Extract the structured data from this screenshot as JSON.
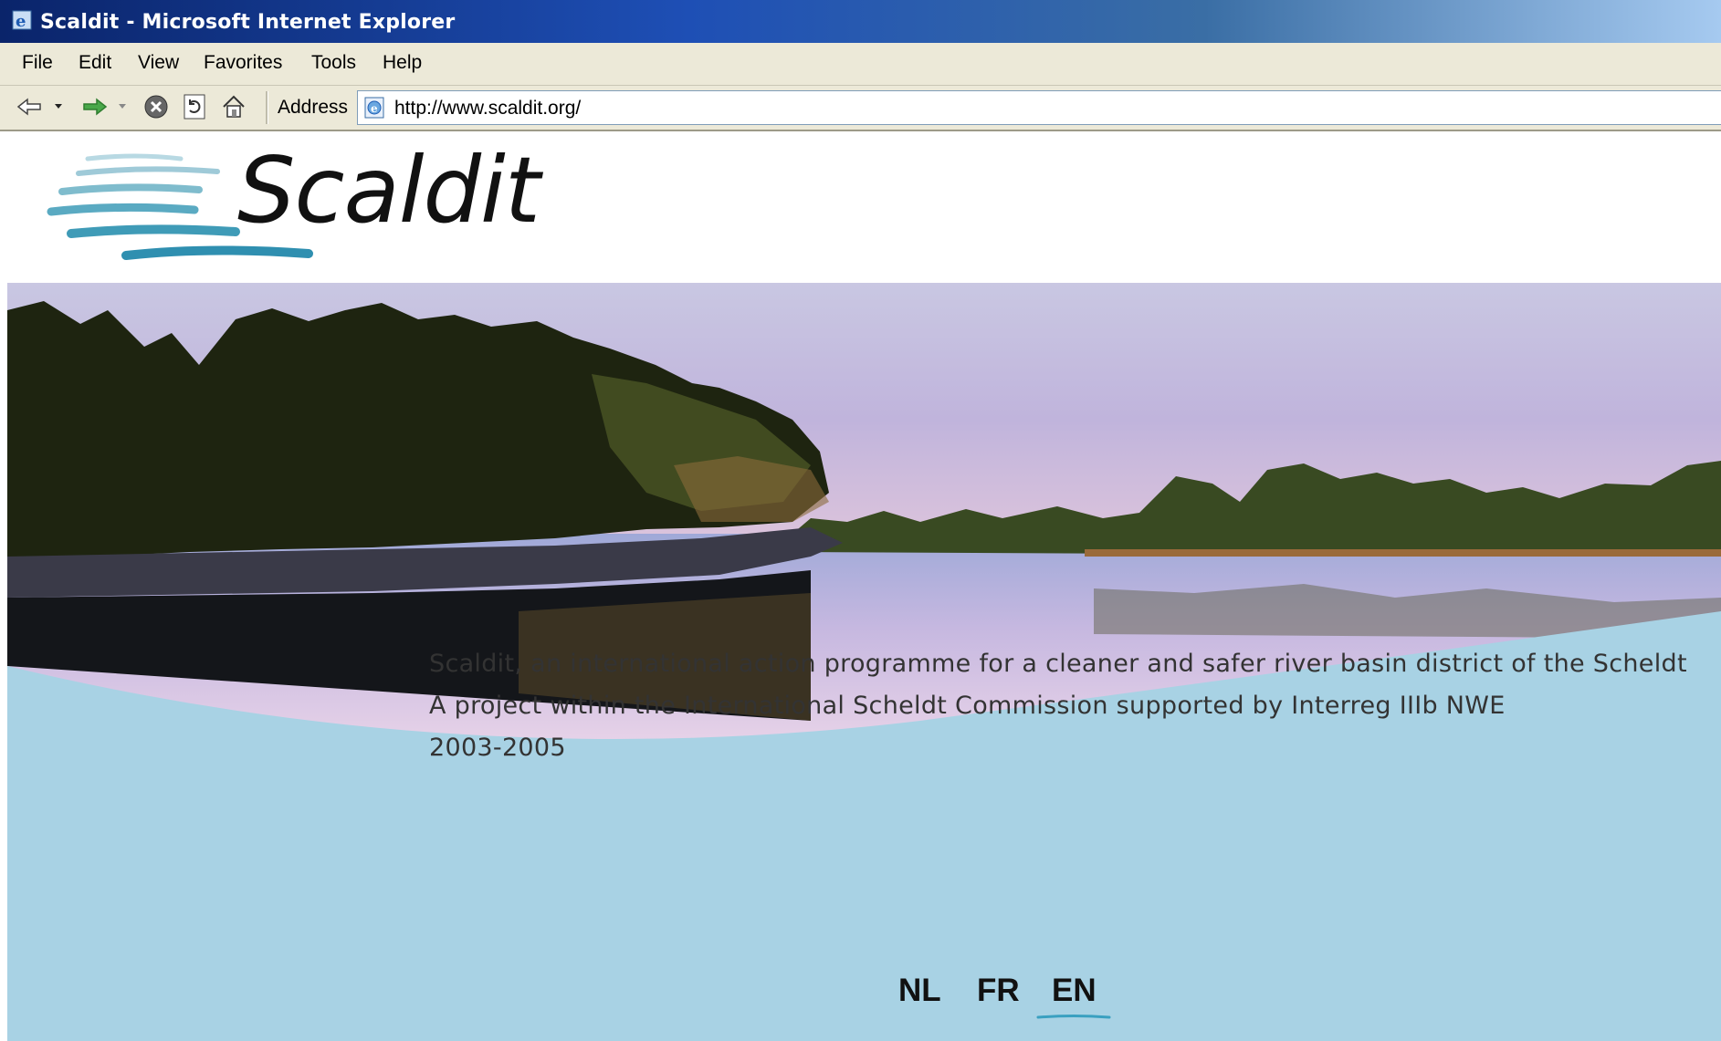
{
  "window": {
    "title": "Scaldit - Microsoft Internet Explorer"
  },
  "menu": [
    "File",
    "Edit",
    "View",
    "Favorites",
    "Tools",
    "Help"
  ],
  "toolbar": {
    "address_label": "Address",
    "url": "http://www.scaldit.org/"
  },
  "site": {
    "logo_text": "Scaldit",
    "tagline": [
      "Scaldit, an international action programme for a cleaner and safer river basin district of the Scheldt",
      "A project within the International Scheldt Commission supported by Interreg IIIb NWE",
      "2003-2005"
    ],
    "languages": [
      "NL",
      "FR",
      "EN"
    ],
    "selected_language": "EN"
  },
  "colors": {
    "accent_blue": "#a6d0e2",
    "wave_blue": "#3aa0c0",
    "titlebar": "#0a246a"
  },
  "icons": [
    "ie-icon",
    "back-arrow-icon",
    "forward-arrow-icon",
    "stop-icon",
    "refresh-icon",
    "home-icon",
    "page-icon"
  ]
}
